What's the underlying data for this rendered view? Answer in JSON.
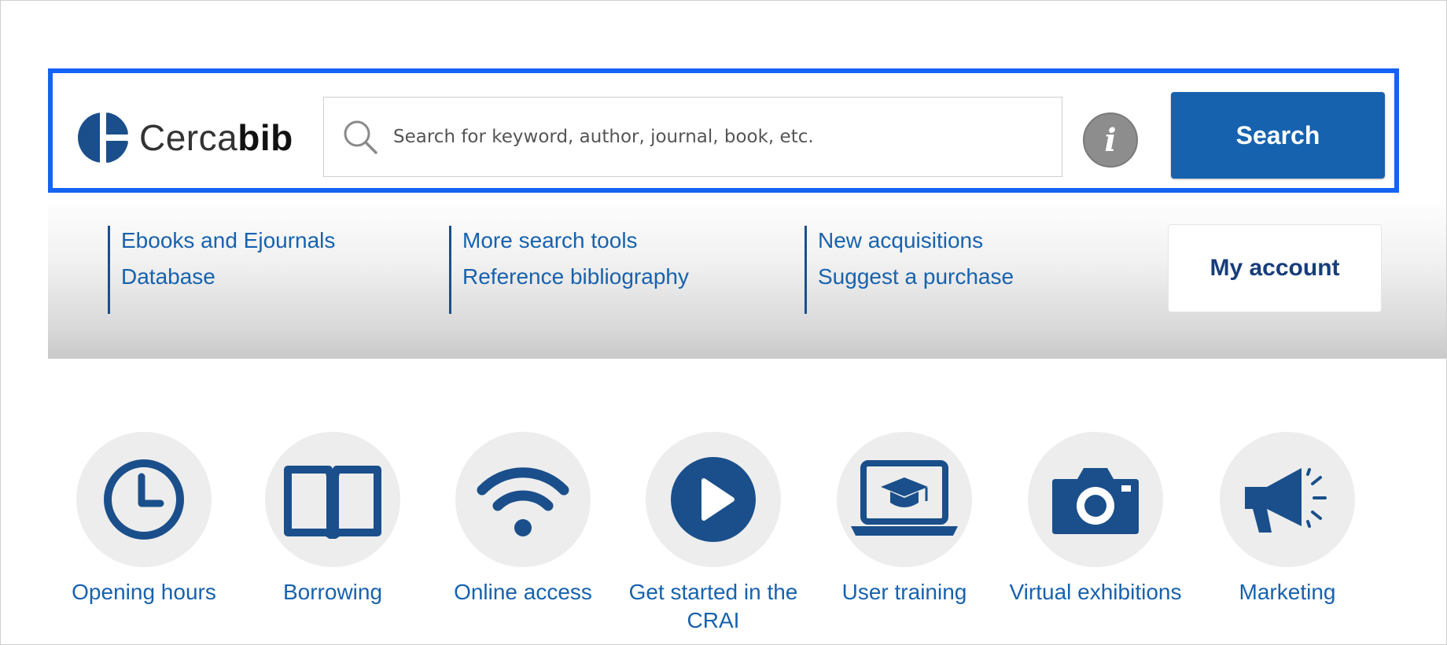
{
  "logo": {
    "text_light": "Cerca",
    "text_bold": "bib"
  },
  "search": {
    "placeholder": "Search for keyword, author, journal, book, etc.",
    "info_label": "i",
    "button_label": "Search"
  },
  "nav": {
    "groups": [
      {
        "items": [
          "Ebooks and Ejournals",
          "Database"
        ]
      },
      {
        "items": [
          "More search tools",
          "Reference bibliography"
        ]
      },
      {
        "items": [
          "New acquisitions",
          "Suggest a purchase"
        ]
      }
    ],
    "account_label": "My account"
  },
  "quick_links": [
    {
      "label": "Opening hours",
      "icon": "clock-icon"
    },
    {
      "label": "Borrowing",
      "icon": "book-icon"
    },
    {
      "label": "Online access",
      "icon": "wifi-icon"
    },
    {
      "label": "Get started in the CRAI",
      "icon": "play-icon"
    },
    {
      "label": "User training",
      "icon": "laptop-graduation-icon"
    },
    {
      "label": "Virtual exhibitions",
      "icon": "camera-icon"
    },
    {
      "label": "Marketing",
      "icon": "megaphone-icon"
    }
  ],
  "colors": {
    "brand_blue": "#1762ae",
    "highlight_border": "#1463f3",
    "icon_bg": "#ededed"
  }
}
